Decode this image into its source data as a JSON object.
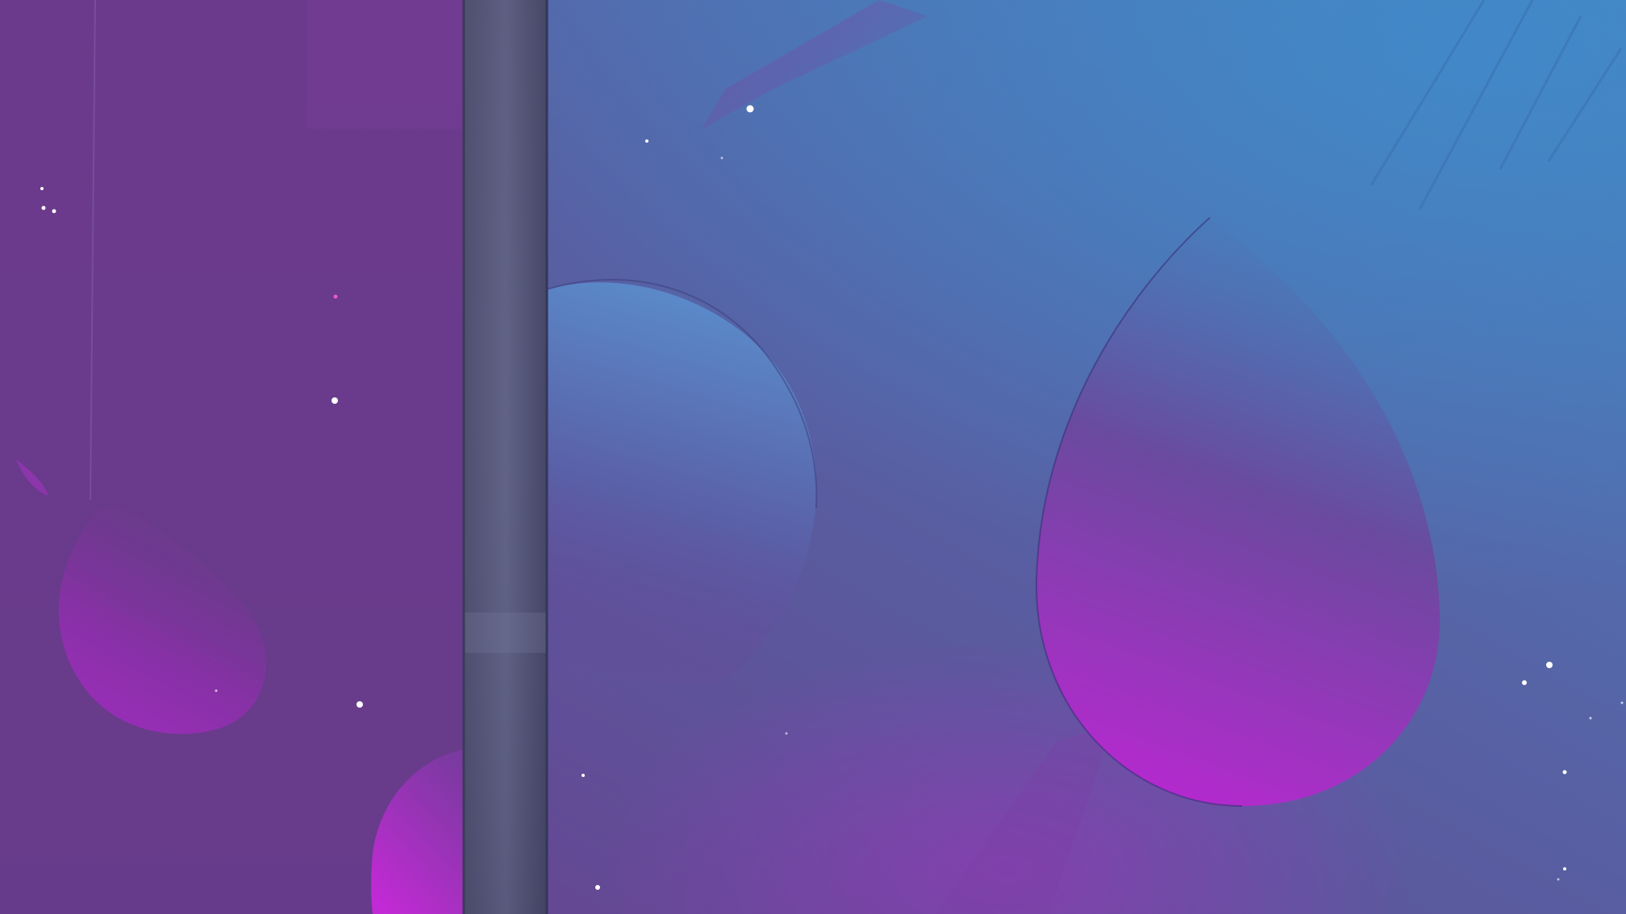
{
  "scene": {
    "description_label": "",
    "palette": {
      "left_panel": "#6a3b8c",
      "right_base_bottom": "#663f8f",
      "right_base_top": "#4f74b8",
      "pillar": "#55597a",
      "orb_blue": "#5a88c8",
      "orb_magenta": "#b52ad0",
      "star": "#ffffff"
    }
  }
}
